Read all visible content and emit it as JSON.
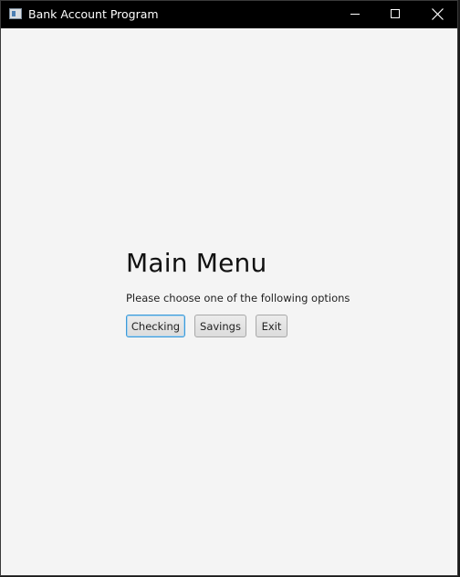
{
  "window": {
    "title": "Bank Account Program",
    "controls": [
      "minimize-icon",
      "maximize-icon",
      "close-icon"
    ]
  },
  "main": {
    "heading": "Main Menu",
    "prompt": "Please choose one of the following options",
    "buttons": [
      {
        "label": "Checking",
        "focused": true
      },
      {
        "label": "Savings",
        "focused": false
      },
      {
        "label": "Exit",
        "focused": false
      }
    ]
  },
  "colors": {
    "titlebar": "#000000",
    "background": "#f4f4f4",
    "focus_border": "#3c9ad8"
  }
}
